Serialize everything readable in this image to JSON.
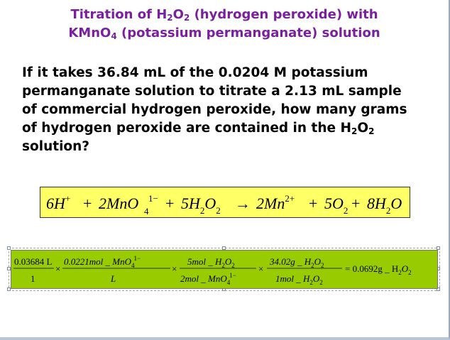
{
  "title": {
    "line1_a": "Titration of H",
    "line1_sub1": "2",
    "line1_b": "O",
    "line1_sub2": "2",
    "line1_c": " (hydrogen peroxide) with",
    "line2_a": "KMnO",
    "line2_sub": "4",
    "line2_b": " (potassium permanganate) solution"
  },
  "question": {
    "line1": "If it takes 36.84 mL of the 0.0204 M potassium",
    "line2": "permanganate solution to titrate a 2.13 mL sample",
    "line3": "of commercial hydrogen peroxide, how many grams",
    "line4_a": "of hydrogen peroxide are contained in the H",
    "line4_sub1": "2",
    "line4_b": "O",
    "line4_sub2": "2",
    "line5": "solution?"
  },
  "equation": {
    "t1": "6H",
    "t1_sup": "+",
    "plus1": "+",
    "t2": "2MnO",
    "t2_sub": "4",
    "t2_sup": "1−",
    "plus2": "+",
    "t3_a": "5H",
    "t3_sub1": "2",
    "t3_b": "O",
    "t3_sub2": "2",
    "arrow": "→",
    "t4": "2Mn",
    "t4_sup": "2+",
    "plus3": "+",
    "t5_a": "5O",
    "t5_sub": "2",
    "plus4": "+",
    "t6_a": "8H",
    "t6_sub": "2",
    "t6_b": "O"
  },
  "calculation": {
    "f1_num": "0.03684 L",
    "f1_den": "1",
    "times1": "×",
    "f2_num_a": "0.0221mol _ MnO",
    "f2_num_sub": "4",
    "f2_num_sup": "1−",
    "f2_den": "L",
    "times2": "×",
    "f3_num_a": "5mol _ H",
    "f3_num_sub1": "2",
    "f3_num_b": "O",
    "f3_num_sub2": "2",
    "f3_den_a": "2mol _ MnO",
    "f3_den_sub": "4",
    "f3_den_sup": "1−",
    "times3": "×",
    "f4_num_a": "34.02g _ H",
    "f4_num_sub1": "2",
    "f4_num_b": "O",
    "f4_num_sub2": "2",
    "f4_den_a": "1mol _ H",
    "f4_den_sub1": "2",
    "f4_den_b": "O",
    "f4_den_sub2": "2",
    "result_a": "= 0.0692g _ H",
    "result_sub1": "2",
    "result_b": "O",
    "result_sub2": "2"
  },
  "colors": {
    "title": "#7a1f9e",
    "equation_bg": "#ffff66",
    "calculation_bg": "#99cc00"
  }
}
